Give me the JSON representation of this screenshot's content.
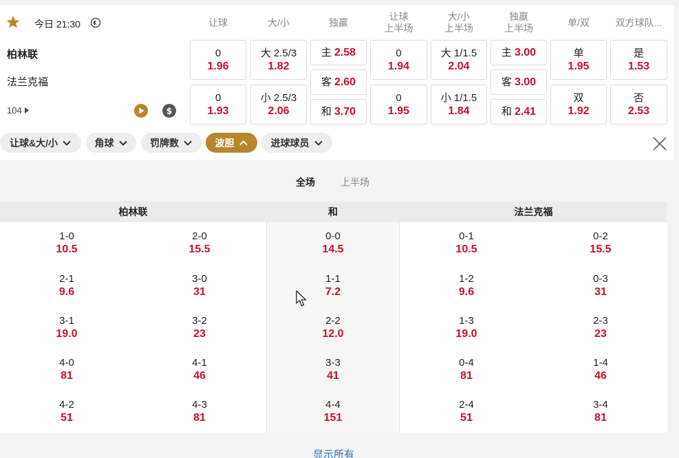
{
  "match": {
    "time": "今日 21:30",
    "home": "柏林联",
    "away": "法兰克福",
    "markets_count": "104"
  },
  "columns": {
    "handicap": "让球",
    "total": "大/小",
    "moneyline": "独赢",
    "handicap_1h_l1": "让球",
    "handicap_1h_l2": "上半场",
    "total_1h_l1": "大/小",
    "total_1h_l2": "上半场",
    "moneyline_1h_l1": "独赢",
    "moneyline_1h_l2": "上半场",
    "odd_even": "单/双",
    "btts": "双方球队..."
  },
  "odds": {
    "handicap": [
      {
        "line": "0",
        "odd": "1.96"
      },
      {
        "line": "0",
        "odd": "1.93"
      }
    ],
    "total": [
      {
        "line": "大 2.5/3",
        "odd": "1.82"
      },
      {
        "line": "小 2.5/3",
        "odd": "2.06"
      }
    ],
    "moneyline": [
      {
        "label": "主",
        "odd": "2.58"
      },
      {
        "label": "客",
        "odd": "2.60"
      },
      {
        "label": "和",
        "odd": "3.70"
      }
    ],
    "handicap_1h": [
      {
        "line": "0",
        "odd": "1.94"
      },
      {
        "line": "0",
        "odd": "1.95"
      }
    ],
    "total_1h": [
      {
        "line": "大 1/1.5",
        "odd": "2.04"
      },
      {
        "line": "小 1/1.5",
        "odd": "1.84"
      }
    ],
    "moneyline_1h": [
      {
        "label": "主",
        "odd": "3.00"
      },
      {
        "label": "客",
        "odd": "3.00"
      },
      {
        "label": "和",
        "odd": "2.41"
      }
    ],
    "odd_even": [
      {
        "label": "单",
        "odd": "1.95"
      },
      {
        "label": "双",
        "odd": "1.92"
      }
    ],
    "btts": [
      {
        "label": "是",
        "odd": "1.53"
      },
      {
        "label": "否",
        "odd": "2.53"
      }
    ]
  },
  "chips": [
    {
      "label": "让球&大/小",
      "active": false
    },
    {
      "label": "角球",
      "active": false
    },
    {
      "label": "罚牌数",
      "active": false
    },
    {
      "label": "波胆",
      "active": true
    },
    {
      "label": "进球球员",
      "active": false
    }
  ],
  "period_tabs": [
    {
      "label": "全场",
      "active": true
    },
    {
      "label": "上半场",
      "active": false
    }
  ],
  "correct_score": {
    "headers": {
      "home": "柏林联",
      "draw": "和",
      "away": "法兰克福"
    },
    "home_col1": [
      {
        "score": "1-0",
        "odd": "10.5"
      },
      {
        "score": "2-1",
        "odd": "9.6"
      },
      {
        "score": "3-1",
        "odd": "19.0"
      },
      {
        "score": "4-0",
        "odd": "81"
      },
      {
        "score": "4-2",
        "odd": "51"
      }
    ],
    "home_col2": [
      {
        "score": "2-0",
        "odd": "15.5"
      },
      {
        "score": "3-0",
        "odd": "31"
      },
      {
        "score": "3-2",
        "odd": "23"
      },
      {
        "score": "4-1",
        "odd": "46"
      },
      {
        "score": "4-3",
        "odd": "81"
      }
    ],
    "draw": [
      {
        "score": "0-0",
        "odd": "14.5"
      },
      {
        "score": "1-1",
        "odd": "7.2"
      },
      {
        "score": "2-2",
        "odd": "12.0"
      },
      {
        "score": "3-3",
        "odd": "41"
      },
      {
        "score": "4-4",
        "odd": "151"
      }
    ],
    "away_col1": [
      {
        "score": "0-1",
        "odd": "10.5"
      },
      {
        "score": "1-2",
        "odd": "9.6"
      },
      {
        "score": "1-3",
        "odd": "19.0"
      },
      {
        "score": "0-4",
        "odd": "81"
      },
      {
        "score": "2-4",
        "odd": "51"
      }
    ],
    "away_col2": [
      {
        "score": "0-2",
        "odd": "15.5"
      },
      {
        "score": "0-3",
        "odd": "31"
      },
      {
        "score": "2-3",
        "odd": "23"
      },
      {
        "score": "1-4",
        "odd": "46"
      },
      {
        "score": "3-4",
        "odd": "81"
      }
    ]
  },
  "show_all": "显示所有",
  "colors": {
    "accent": "#b8862b",
    "odd_red": "#c8102e",
    "link_blue": "#2a6fb8"
  }
}
